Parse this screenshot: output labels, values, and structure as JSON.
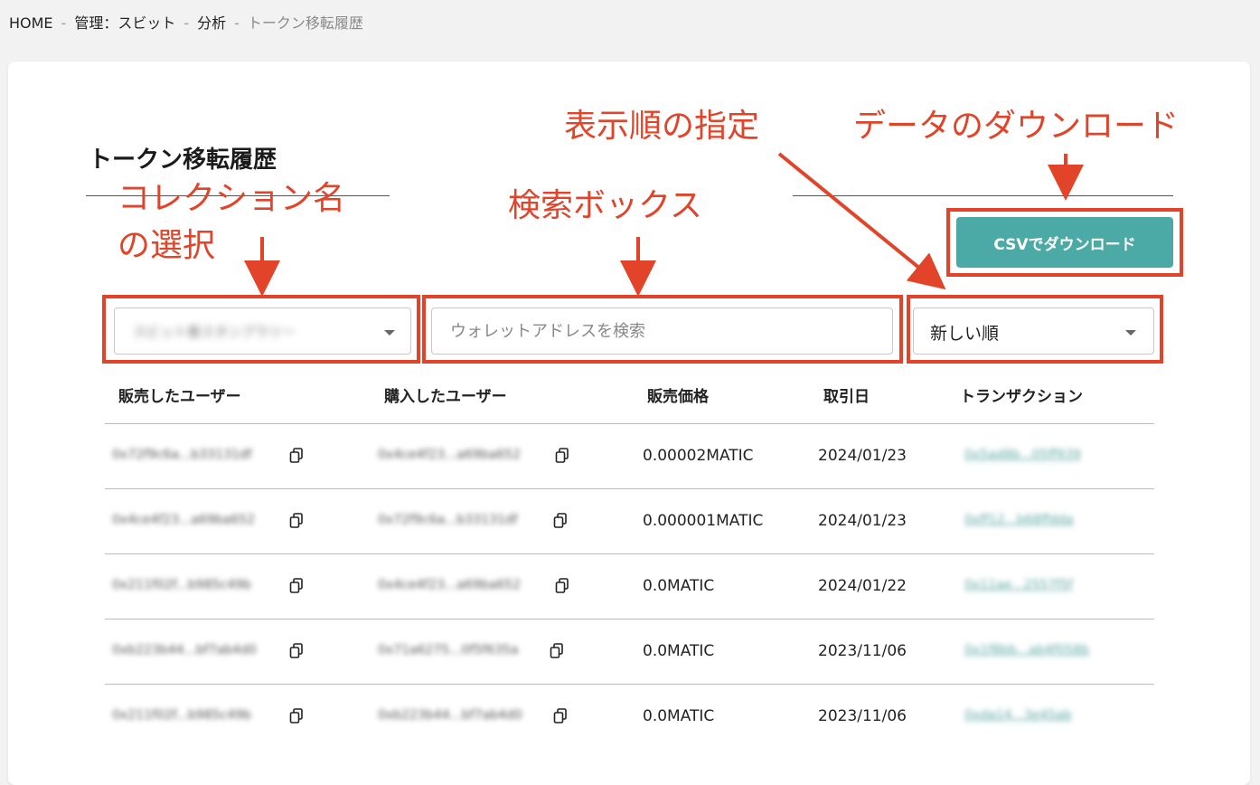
{
  "breadcrumb": {
    "items": [
      "HOME",
      "管理：スビット",
      "分析"
    ],
    "current": "トークン移転履歴",
    "separator": "-"
  },
  "page": {
    "title": "トークン移転履歴"
  },
  "controls": {
    "collection_selected": "スビット春スタンプラリー",
    "search_placeholder": "ウォレットアドレスを検索",
    "sort_selected": "新しい順",
    "csv_button": "CSVでダウンロード"
  },
  "annotations": {
    "collection_line1": "コレクション名",
    "collection_line2": "の選択",
    "search": "検索ボックス",
    "sort": "表示順の指定",
    "download": "データのダウンロード",
    "color": "#e2442a"
  },
  "table": {
    "headers": [
      "販売したユーザー",
      "購入したユーザー",
      "販売価格",
      "取引日",
      "トランザクション"
    ],
    "rows": [
      {
        "seller": "0x72f9c6a...b33131df",
        "buyer": "0x4ce4f23...a69ba652",
        "price": "0.00002MATIC",
        "date": "2024/01/23",
        "tx": "0x5ad8b...05ff939"
      },
      {
        "seller": "0x4ce4f23...a69ba652",
        "buyer": "0x72f9c6a...b33131df",
        "price": "0.000001MATIC",
        "date": "2024/01/23",
        "tx": "0xff12...b68ffdda"
      },
      {
        "seller": "0x211f02f...b985c49b",
        "buyer": "0x4ce4f23...a69ba652",
        "price": "0.0MATIC",
        "date": "2024/01/22",
        "tx": "0x11ae...2557f5f"
      },
      {
        "seller": "0xb223b44...bf7ab4d0",
        "buyer": "0x71a6275...0f5f635a",
        "price": "0.0MATIC",
        "date": "2023/11/06",
        "tx": "0x1f8bb...ab4f058b"
      },
      {
        "seller": "0x211f02f...b985c49b",
        "buyer": "0xb223b44...bf7ab4d0",
        "price": "0.0MATIC",
        "date": "2023/11/06",
        "tx": "0xda14...3e45ab"
      }
    ]
  },
  "theme": {
    "accent": "#4caaa6",
    "annotation": "#e2442a"
  }
}
